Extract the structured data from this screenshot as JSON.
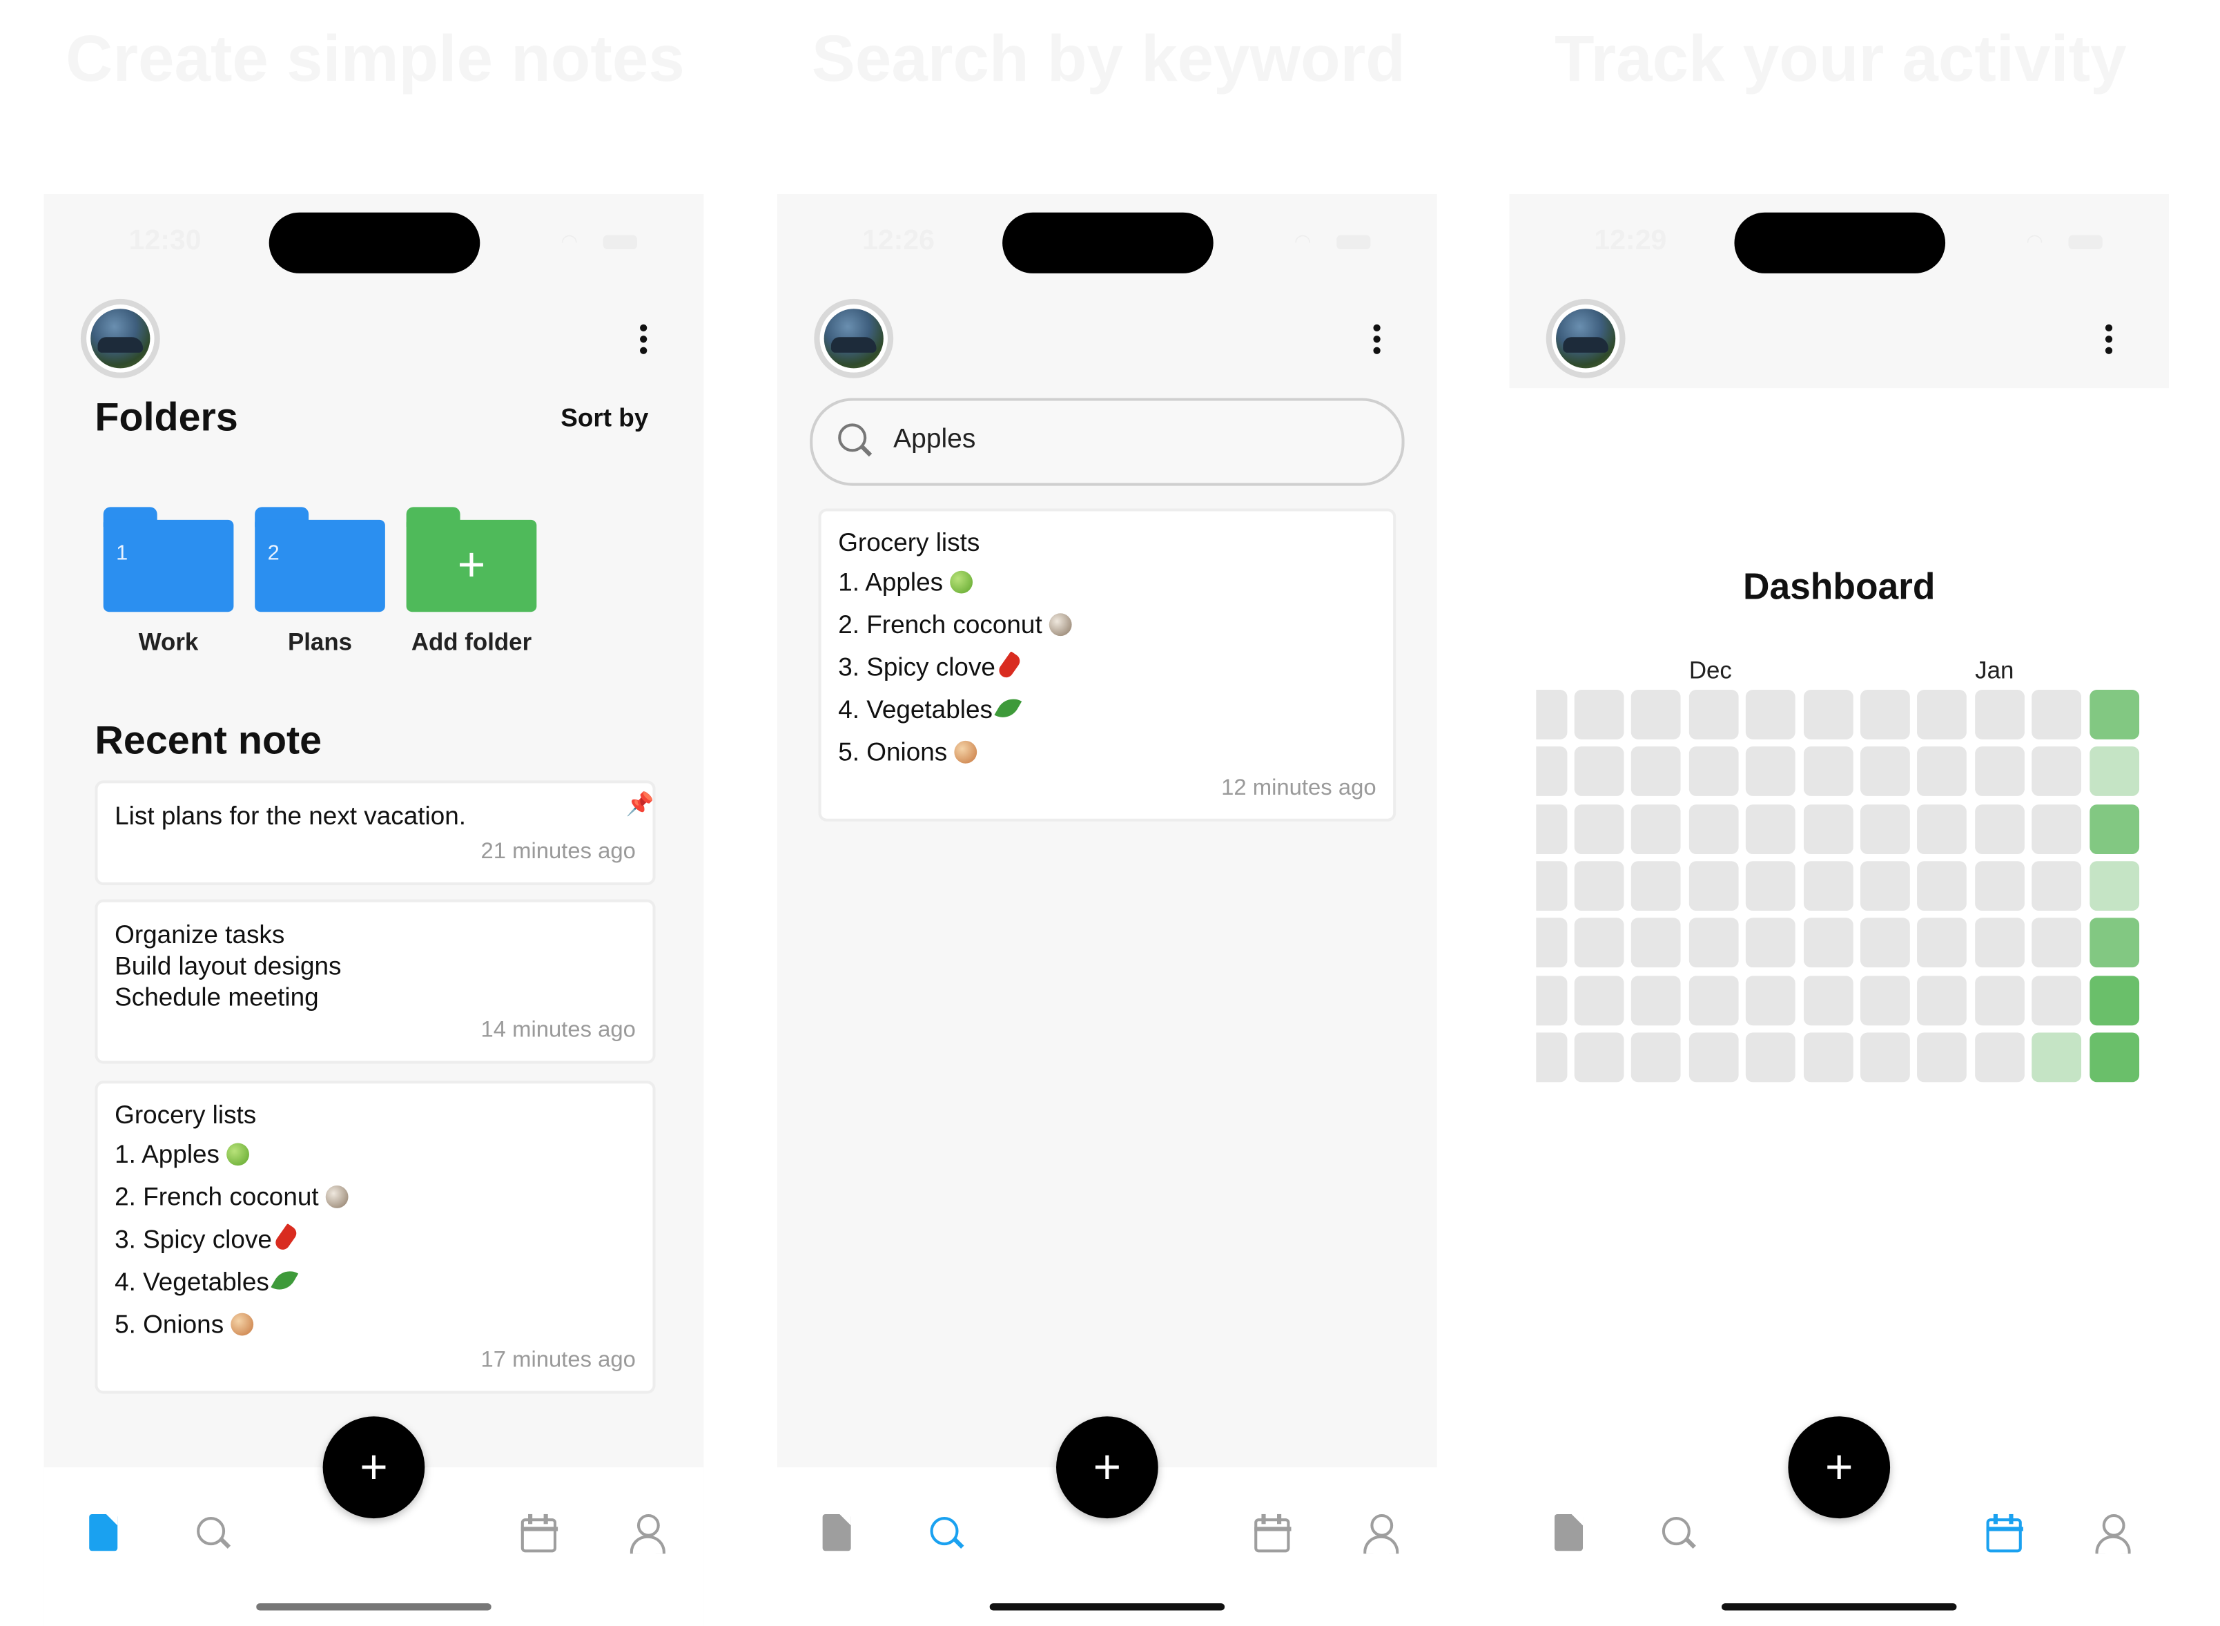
{
  "headlines": [
    "Create simple notes",
    "Search by keyword",
    "Track your activity"
  ],
  "colors": {
    "accent": "#1aa1f0",
    "nav_inactive": "#9e9e9e",
    "folder_blue": "#2b8ff0",
    "folder_green": "#4fba5a",
    "heat_empty": "#e6e6e6",
    "heat_light": "#c5e4c5",
    "heat_mid": "#82c882",
    "heat_dark": "#6abf6a"
  },
  "screens": [
    {
      "time": "12:30",
      "section_title": "Folders",
      "sort_label": "Sort by",
      "folders": [
        {
          "number": "1",
          "label": "Work"
        },
        {
          "number": "2",
          "label": "Plans"
        },
        {
          "icon": "plus-icon",
          "label": "Add folder"
        }
      ],
      "recent_title": "Recent note",
      "notes": [
        {
          "lines": [
            "List plans for the next vacation."
          ],
          "pinned": true,
          "time_ago": "21 minutes ago"
        },
        {
          "lines": [
            "Organize tasks",
            "Build layout designs",
            "Schedule meeting"
          ],
          "time_ago": "14 minutes ago"
        },
        {
          "lines": [
            "Grocery lists",
            "1. Apples",
            "2. French coconut",
            "3. Spicy clove",
            "4. Vegetables",
            "5. Onions"
          ],
          "time_ago": "17 minutes ago"
        }
      ],
      "active_tab": "notes"
    },
    {
      "time": "12:26",
      "search": {
        "value": "Apples"
      },
      "results": [
        {
          "lines": [
            "Grocery lists",
            "1. Apples",
            "2. French coconut",
            "3. Spicy clove",
            "4. Vegetables",
            "5. Onions"
          ],
          "time_ago": "12 minutes ago"
        }
      ],
      "active_tab": "search"
    },
    {
      "time": "12:29",
      "dashboard_title": "Dashboard",
      "months": [
        "Dec",
        "Jan"
      ],
      "activity_levels_last_two_columns": {
        "column_10": [
          0,
          0,
          0,
          0,
          0,
          0,
          1
        ],
        "column_11": [
          2,
          1,
          2,
          1,
          2,
          3,
          3
        ]
      },
      "active_tab": "calendar"
    }
  ],
  "nav_tabs": [
    {
      "id": "notes",
      "icon": "document-icon"
    },
    {
      "id": "search",
      "icon": "search-icon"
    },
    {
      "id": "calendar",
      "icon": "calendar-icon"
    },
    {
      "id": "profile",
      "icon": "user-icon"
    }
  ],
  "fab_icon": "plus-icon",
  "fab_label": "+",
  "add_folder_symbol": "+",
  "pin_symbol": "📌"
}
